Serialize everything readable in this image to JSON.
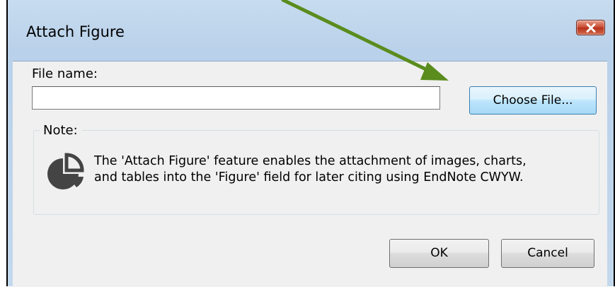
{
  "window": {
    "title": "Attach Figure",
    "close_icon": "close-x-icon"
  },
  "file": {
    "label": "File name:",
    "value": "",
    "placeholder": ""
  },
  "buttons": {
    "choose_file": "Choose File...",
    "ok": "OK",
    "cancel": "Cancel"
  },
  "note": {
    "label": "Note:",
    "icon": "pie-chart-icon",
    "line1": "The 'Attach Figure' feature enables the attachment of images, charts,",
    "line2": "and tables into the 'Figure' field for later citing using EndNote CWYW."
  },
  "annotation": {
    "arrow_color": "#5a8c1e",
    "arrow_icon": "arrow-pointer-icon"
  },
  "colors": {
    "title_bar": "#b9d1ea",
    "client_bg": "#f0f0f0",
    "close_button": "#c7472e"
  }
}
